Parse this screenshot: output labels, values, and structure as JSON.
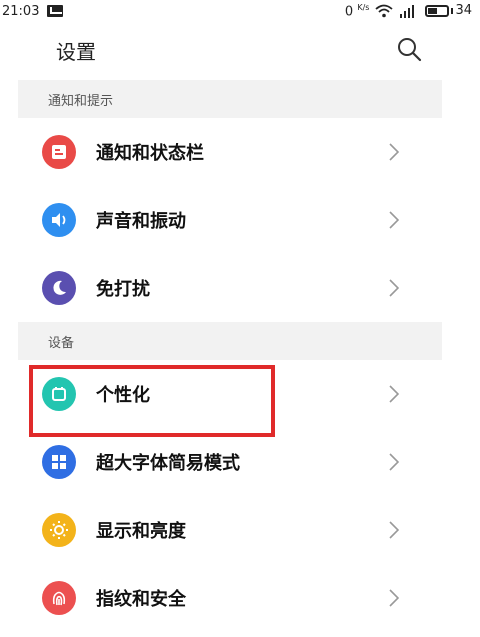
{
  "status_bar": {
    "time": "21:03",
    "speed": "0",
    "speed_unit": "K/s",
    "battery": "34"
  },
  "header": {
    "title": "设置"
  },
  "sections": [
    {
      "title": "通知和提示",
      "items": [
        {
          "label": "通知和状态栏",
          "icon": "notification-icon",
          "color": "#e94a47"
        },
        {
          "label": "声音和振动",
          "icon": "sound-icon",
          "color": "#2f8ff0"
        },
        {
          "label": "免打扰",
          "icon": "moon-icon",
          "color": "#5a4fb0"
        }
      ]
    },
    {
      "title": "设备",
      "items": [
        {
          "label": "个性化",
          "icon": "personalization-icon",
          "color": "#23c5b0"
        },
        {
          "label": "超大字体简易模式",
          "icon": "grid-icon",
          "color": "#2f6ee3"
        },
        {
          "label": "显示和亮度",
          "icon": "sun-icon",
          "color": "#f3b31a"
        },
        {
          "label": "指纹和安全",
          "icon": "fingerprint-icon",
          "color": "#ec5050"
        }
      ]
    }
  ],
  "colors": {
    "highlight_border": "#e02a2a",
    "section_bg": "#f2f2f2"
  }
}
